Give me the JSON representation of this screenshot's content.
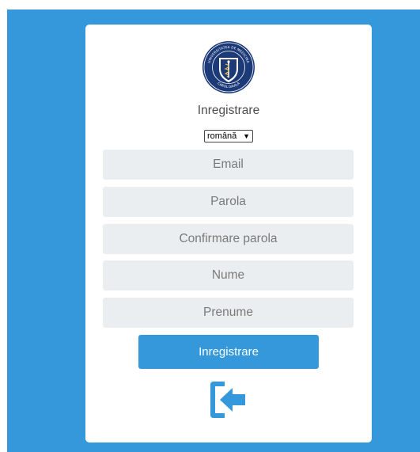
{
  "logo": {
    "icon": "university-seal-icon",
    "seal_text": "UNIVERSITATEA DE MEDICINA SI FARMACIE CAROL DAVILA"
  },
  "form": {
    "title": "Inregistrare",
    "language_select": {
      "selected": "română"
    },
    "fields": {
      "email_placeholder": "Email",
      "password_placeholder": "Parola",
      "confirm_password_placeholder": "Confirmare parola",
      "last_name_placeholder": "Nume",
      "first_name_placeholder": "Prenume"
    },
    "submit_label": "Inregistrare",
    "login_icon": "sign-in-icon"
  },
  "colors": {
    "accent": "#3498db",
    "field_bg": "#ebeef0",
    "seal_navy": "#1d3a78"
  }
}
